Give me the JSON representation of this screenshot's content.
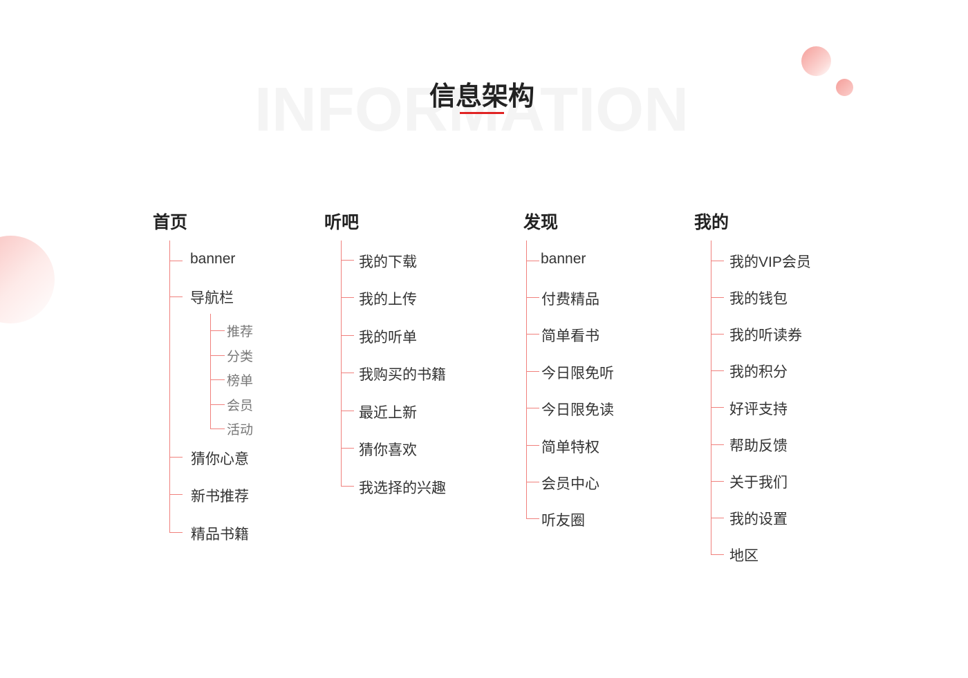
{
  "header": {
    "watermark": "INFORMATION",
    "title": "信息架构"
  },
  "colors": {
    "accent": "#e02424",
    "line": "#f0807c",
    "circle": "#f59e9a"
  },
  "columns": [
    {
      "title": "首页",
      "items": [
        "banner",
        "导航栏",
        "猜你心意",
        "新书推荐",
        "精品书籍"
      ],
      "subitems": [
        "推荐",
        "分类",
        "榜单",
        "会员",
        "活动"
      ]
    },
    {
      "title": "听吧",
      "items": [
        "我的下载",
        "我的上传",
        "我的听单",
        "我购买的书籍",
        "最近上新",
        "猜你喜欢",
        "我选择的兴趣"
      ]
    },
    {
      "title": "发现",
      "items": [
        "banner",
        "付费精品",
        "简单看书",
        "今日限免听",
        "今日限免读",
        "简单特权",
        "会员中心",
        "听友圈"
      ]
    },
    {
      "title": "我的",
      "items": [
        "我的VIP会员",
        "我的钱包",
        "我的听读券",
        "我的积分",
        "好评支持",
        "帮助反馈",
        "关于我们",
        "我的设置",
        "地区"
      ]
    }
  ]
}
